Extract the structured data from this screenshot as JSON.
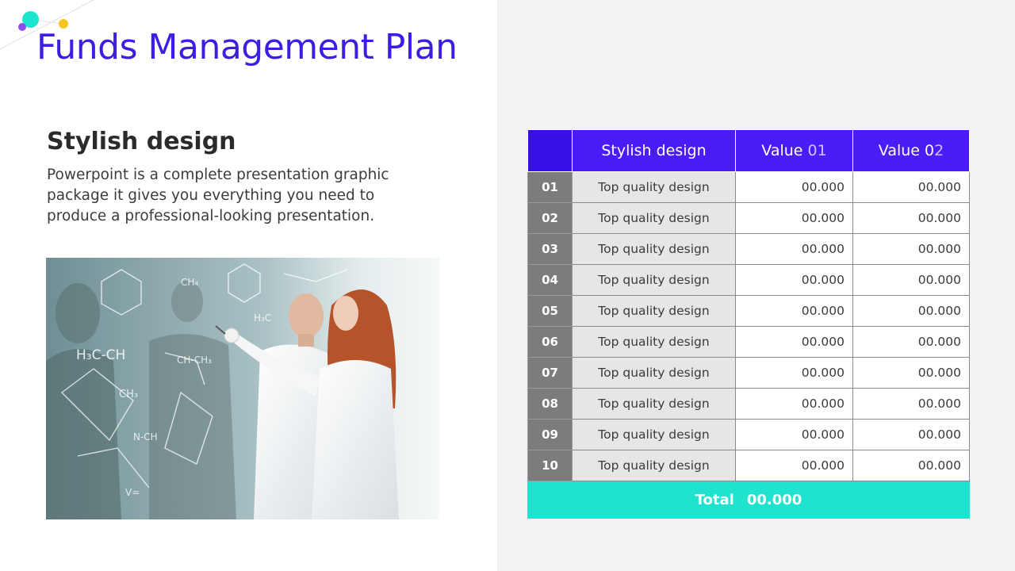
{
  "slide": {
    "title": "Funds Management Plan",
    "section": {
      "heading": "Stylish design",
      "body": "Powerpoint is a complete presentation graphic package it gives you everything you need to produce a professional-looking presentation."
    },
    "photo": {
      "board_text": [
        "H₃C-CH",
        "CH₃",
        "CH₄",
        "H₃C",
        "N-CH",
        "V=",
        "CH-CH₃"
      ]
    }
  },
  "table": {
    "header": {
      "name": "Stylish design",
      "value1_main": "Value ",
      "value1_faded": "01",
      "value2_main": "Value 0",
      "value2_faded": "2"
    },
    "rows": [
      {
        "index": "01",
        "name": "Top quality design",
        "value1": "00.000",
        "value2": "00.000"
      },
      {
        "index": "02",
        "name": "Top quality design",
        "value1": "00.000",
        "value2": "00.000"
      },
      {
        "index": "03",
        "name": "Top quality design",
        "value1": "00.000",
        "value2": "00.000"
      },
      {
        "index": "04",
        "name": "Top quality design",
        "value1": "00.000",
        "value2": "00.000"
      },
      {
        "index": "05",
        "name": "Top quality design",
        "value1": "00.000",
        "value2": "00.000"
      },
      {
        "index": "06",
        "name": "Top quality design",
        "value1": "00.000",
        "value2": "00.000"
      },
      {
        "index": "07",
        "name": "Top quality design",
        "value1": "00.000",
        "value2": "00.000"
      },
      {
        "index": "08",
        "name": "Top quality design",
        "value1": "00.000",
        "value2": "00.000"
      },
      {
        "index": "09",
        "name": "Top quality design",
        "value1": "00.000",
        "value2": "00.000"
      },
      {
        "index": "10",
        "name": "Top quality design",
        "value1": "00.000",
        "value2": "00.000"
      }
    ],
    "footer": {
      "label": "Total",
      "value": "00.000"
    }
  },
  "colors": {
    "title": "#3a1ee3",
    "header_bg": "#4a1cf7",
    "total_bg": "#1fe3cf",
    "index_bg": "#7c7c7c",
    "name_bg": "#e6e6e6",
    "right_panel_bg": "#f2f2f2",
    "dot_teal": "#1de5cf",
    "dot_purple": "#8e4cf0",
    "dot_yellow": "#f7c520"
  },
  "icons": [
    "decorative-dot-teal",
    "decorative-dot-purple",
    "decorative-dot-yellow"
  ]
}
